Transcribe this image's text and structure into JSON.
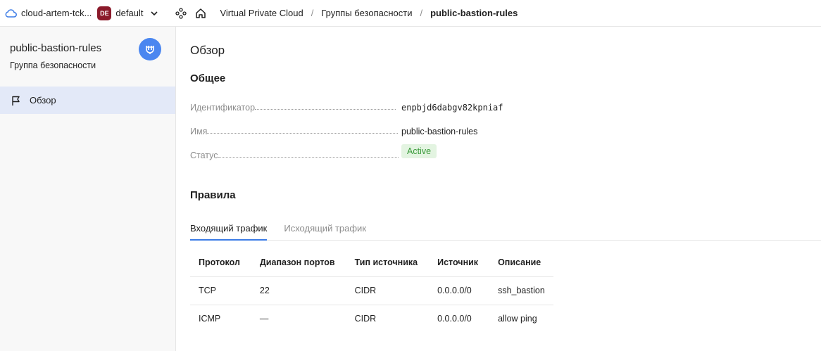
{
  "topbar": {
    "cloud_name": "cloud-artem-tck...",
    "folder_badge": "DE",
    "folder_name": "default",
    "breadcrumbs": [
      "Virtual Private Cloud",
      "Группы безопасности"
    ],
    "current": "public-bastion-rules",
    "separator": "/"
  },
  "sidebar": {
    "title": "public-bastion-rules",
    "subtitle": "Группа безопасности",
    "items": [
      {
        "label": "Обзор",
        "icon": "flag-icon",
        "active": true
      }
    ]
  },
  "main": {
    "heading": "Обзор",
    "general_heading": "Общее",
    "properties": [
      {
        "key": "Идентификатор",
        "value": "enpbjd6dabgv82kpniaf"
      },
      {
        "key": "Имя",
        "value": "public-bastion-rules"
      },
      {
        "key": "Статус",
        "value": "Active"
      }
    ],
    "rules_heading": "Правила",
    "tabs": [
      {
        "label": "Входящий трафик",
        "active": true
      },
      {
        "label": "Исходящий трафик",
        "active": false
      }
    ],
    "table": {
      "headers": [
        "Протокол",
        "Диапазон портов",
        "Тип источника",
        "Источник",
        "Описание"
      ],
      "rows": [
        [
          "TCP",
          "22",
          "CIDR",
          "0.0.0.0/0",
          "ssh_bastion"
        ],
        [
          "ICMP",
          "—",
          "CIDR",
          "0.0.0.0/0",
          "allow ping"
        ]
      ]
    }
  },
  "colors": {
    "accent": "#3b7be6",
    "folder_badge": "#8b1a2b",
    "avatar": "#4a86f0",
    "status_bg": "#e3f4e1",
    "status_text": "#3a9a3a",
    "sidebar_active": "#e3e9f8"
  }
}
